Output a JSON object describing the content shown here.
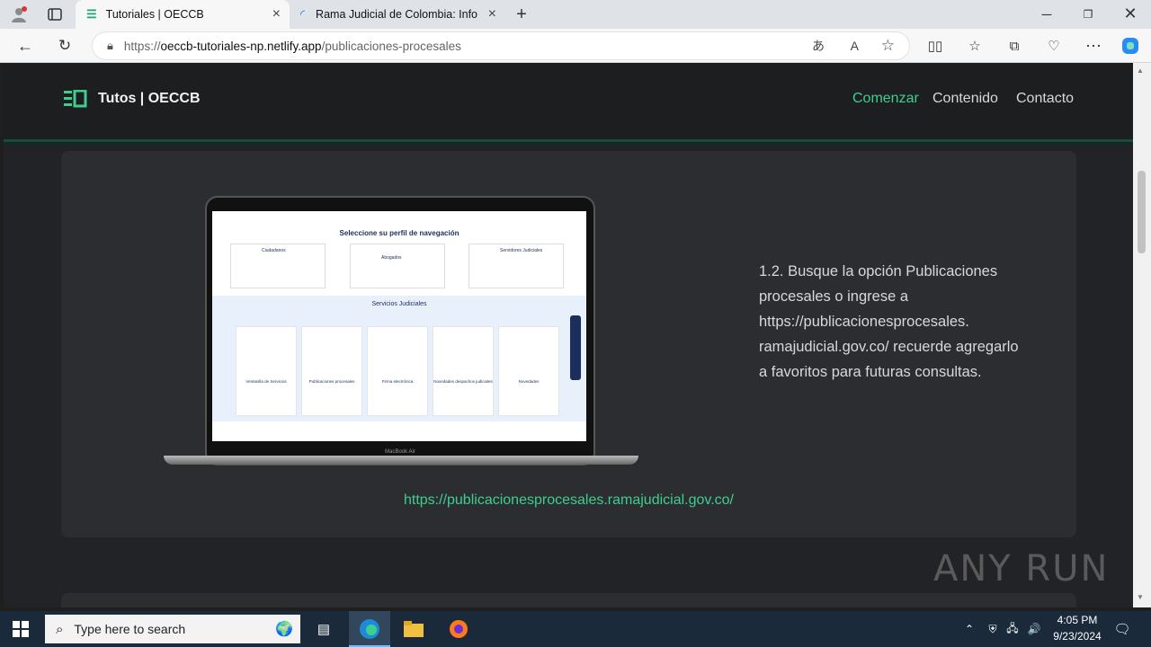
{
  "browser": {
    "tabs": [
      {
        "title": "Tutoriales | OECCB",
        "active": true
      },
      {
        "title": "Rama Judicial de Colombia: Infor",
        "active": false
      }
    ],
    "url_prefix": "https://",
    "url_host": "oeccb-tutoriales-np.netlify.app",
    "url_path": "/publicaciones-procesales"
  },
  "site": {
    "brand": "Tutos | OECCB",
    "nav": [
      "Comenzar",
      "Contenido",
      "Contacto"
    ],
    "accent": "#3ecf8e"
  },
  "card": {
    "instruction": "1.2. Busque la opción Publicaciones procesales o ingrese a https://publicacionesprocesales. ramajudicial.gov.co/ recuerde agregarlo a favoritos para futuras consultas.",
    "link": "https://publicacionesprocesales.ramajudicial.gov.co/"
  },
  "screenshot_inner": {
    "title": "Seleccione su perfil de navegación",
    "profiles": [
      "Ciudadanos",
      "Abogados",
      "Servidores Judiciales"
    ],
    "section": "Servicios Judiciales",
    "services": [
      "Ventanilla de Servicios",
      "Publicaciones procesales",
      "Firma electrónica",
      "Novedades despachos judiciales",
      "Novedades"
    ],
    "device_label": "MacBook Air"
  },
  "watermark": "ANY RUN",
  "taskbar": {
    "search_placeholder": "Type here to search",
    "time": "4:05 PM",
    "date": "9/23/2024"
  }
}
